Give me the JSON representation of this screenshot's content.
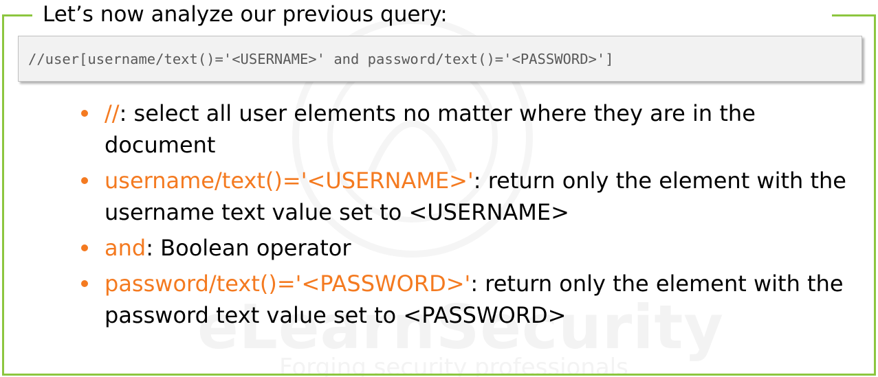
{
  "title": "Let’s now analyze our previous query:",
  "code": "//user[username/text()='<USERNAME>' and password/text()='<PASSWORD>']",
  "watermark": {
    "brand": "eLearnSecurity",
    "tagline": "Forging security professionals"
  },
  "bullets": [
    {
      "term": "//",
      "rest": ": select all user elements no matter where they are in the document"
    },
    {
      "term": "username/text()='<USERNAME>'",
      "rest": ": return only the element with the username text value set to <USERNAME>"
    },
    {
      "term": "and",
      "rest": ": Boolean operator"
    },
    {
      "term": "password/text()='<PASSWORD>'",
      "rest": ": return only the element with the password text value set to <PASSWORD>"
    }
  ],
  "colors": {
    "frame": "#8cc63f",
    "accent": "#f47a20",
    "code_bg": "#f2f2f2",
    "code_text": "#595959"
  }
}
